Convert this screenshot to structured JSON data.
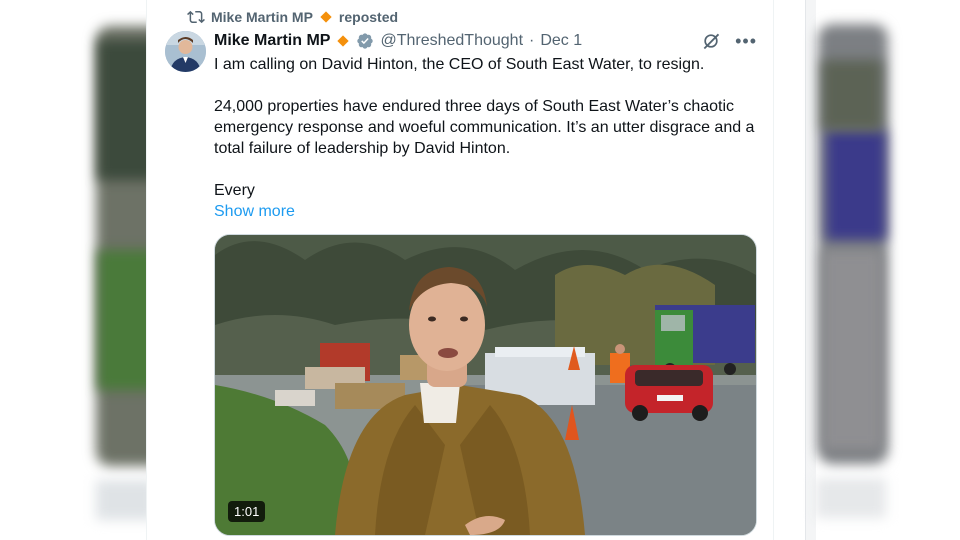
{
  "repost": {
    "name": "Mike Martin MP",
    "label": "reposted"
  },
  "tweet": {
    "author_name": "Mike Martin MP",
    "handle": "@ThreshedThought",
    "separator": "·",
    "date": "Dec 1",
    "paragraphs": [
      "I am calling on David Hinton, the CEO of South East Water, to resign.",
      "24,000 properties have endured three days of South East Water’s chaotic emergency response and woeful communication. It’s an utter disgrace and a total failure of leadership by David Hinton.",
      "Every"
    ],
    "show_more": "Show more",
    "video_duration": "1:01"
  },
  "icons": {
    "repost": "repost-icon",
    "affiliate": "orange-diamond-icon",
    "verified": "verified-badge-icon",
    "grok": "grok-icon",
    "more": "more-options-icon"
  },
  "colors": {
    "accent": "#1d9bf0",
    "secondary_text": "#536471",
    "diamond": "#f4900c"
  }
}
